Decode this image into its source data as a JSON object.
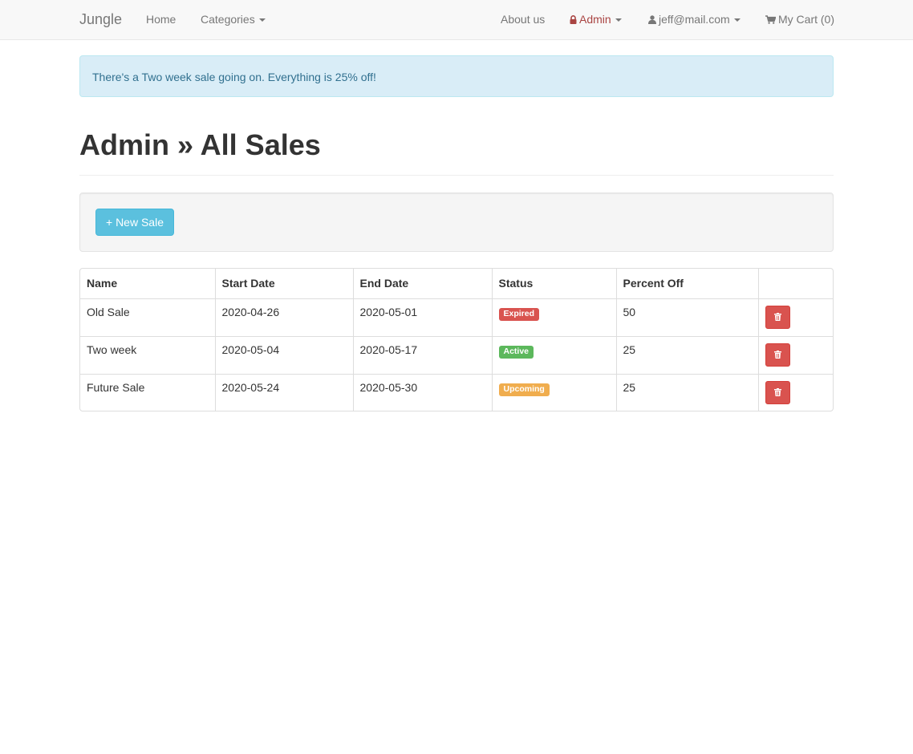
{
  "navbar": {
    "brand": "Jungle",
    "home": "Home",
    "categories": "Categories",
    "about": "About us",
    "admin": "Admin",
    "user_email": "jeff@mail.com",
    "cart": "My Cart (0)",
    "icons": {
      "admin": "lock-icon",
      "user": "user-icon",
      "cart": "shopping-cart-icon"
    }
  },
  "alert": {
    "text": "There's a Two week sale going on. Everything is 25% off!"
  },
  "page": {
    "title": "Admin » All Sales"
  },
  "toolbar": {
    "new_sale": "+ New Sale"
  },
  "table": {
    "headers": [
      "Name",
      "Start Date",
      "End Date",
      "Status",
      "Percent Off",
      ""
    ],
    "rows": [
      {
        "name": "Old Sale",
        "start": "2020-04-26",
        "end": "2020-05-01",
        "status": "Expired",
        "status_color": "#d9534f",
        "percent": "50",
        "action_icon": "trash-icon"
      },
      {
        "name": "Two week",
        "start": "2020-05-04",
        "end": "2020-05-17",
        "status": "Active",
        "status_color": "#5cb85c",
        "percent": "25",
        "action_icon": "trash-icon"
      },
      {
        "name": "Future Sale",
        "start": "2020-05-24",
        "end": "2020-05-30",
        "status": "Upcoming",
        "status_color": "#f0ad4e",
        "percent": "25",
        "action_icon": "trash-icon"
      }
    ]
  },
  "colors": {
    "navbar_bg": "#f8f8f8",
    "admin_link": "#a94442",
    "alert_bg": "#d9edf7",
    "alert_text": "#31708f",
    "info_button": "#5bc0de",
    "danger_button": "#d9534f"
  }
}
